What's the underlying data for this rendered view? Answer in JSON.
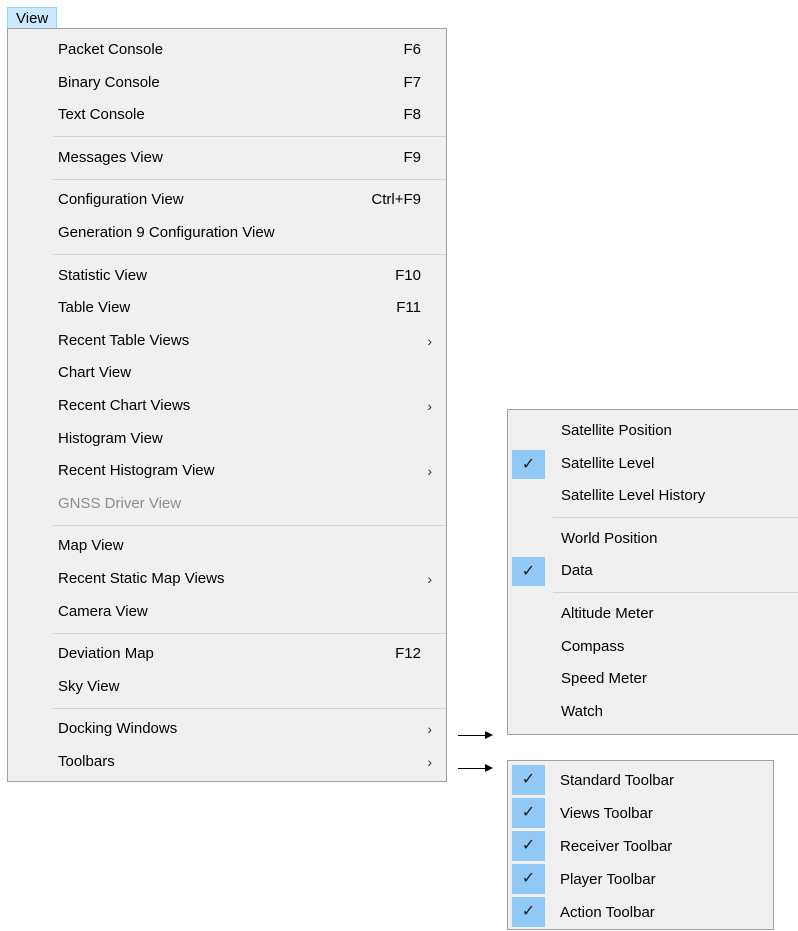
{
  "menubar": {
    "view_label": "View"
  },
  "view_menu": {
    "groups": [
      [
        {
          "label": "Packet Console",
          "shortcut": "F6"
        },
        {
          "label": "Binary Console",
          "shortcut": "F7"
        },
        {
          "label": "Text Console",
          "shortcut": "F8"
        }
      ],
      [
        {
          "label": "Messages View",
          "shortcut": "F9"
        }
      ],
      [
        {
          "label": "Configuration View",
          "shortcut": "Ctrl+F9"
        },
        {
          "label": "Generation 9 Configuration View"
        }
      ],
      [
        {
          "label": "Statistic View",
          "shortcut": "F10"
        },
        {
          "label": "Table View",
          "shortcut": "F11"
        },
        {
          "label": "Recent Table Views",
          "submenu": true
        },
        {
          "label": "Chart View"
        },
        {
          "label": "Recent Chart Views",
          "submenu": true
        },
        {
          "label": "Histogram View"
        },
        {
          "label": "Recent Histogram View",
          "submenu": true
        },
        {
          "label": "GNSS Driver View",
          "disabled": true
        }
      ],
      [
        {
          "label": "Map View"
        },
        {
          "label": "Recent Static Map Views",
          "submenu": true
        },
        {
          "label": "Camera View"
        }
      ],
      [
        {
          "label": "Deviation Map",
          "shortcut": "F12"
        },
        {
          "label": "Sky View"
        }
      ],
      [
        {
          "label": "Docking Windows",
          "submenu": true
        },
        {
          "label": "Toolbars",
          "submenu": true
        }
      ]
    ]
  },
  "docking_menu": {
    "groups": [
      [
        {
          "label": "Satellite Position",
          "checked": false
        },
        {
          "label": "Satellite Level",
          "checked": true
        },
        {
          "label": "Satellite Level History",
          "checked": false
        }
      ],
      [
        {
          "label": "World Position",
          "checked": false
        },
        {
          "label": "Data",
          "checked": true
        }
      ],
      [
        {
          "label": "Altitude Meter",
          "checked": false
        },
        {
          "label": "Compass",
          "checked": false
        },
        {
          "label": "Speed Meter",
          "checked": false
        },
        {
          "label": "Watch",
          "checked": false
        }
      ]
    ]
  },
  "toolbars_menu": {
    "items": [
      {
        "label": "Standard Toolbar",
        "checked": true
      },
      {
        "label": "Views Toolbar",
        "checked": true
      },
      {
        "label": "Receiver Toolbar",
        "checked": true
      },
      {
        "label": "Player Toolbar",
        "checked": true
      },
      {
        "label": "Action Toolbar",
        "checked": true
      }
    ]
  },
  "glyphs": {
    "submenu_arrow": "›",
    "checkmark": "✓"
  }
}
